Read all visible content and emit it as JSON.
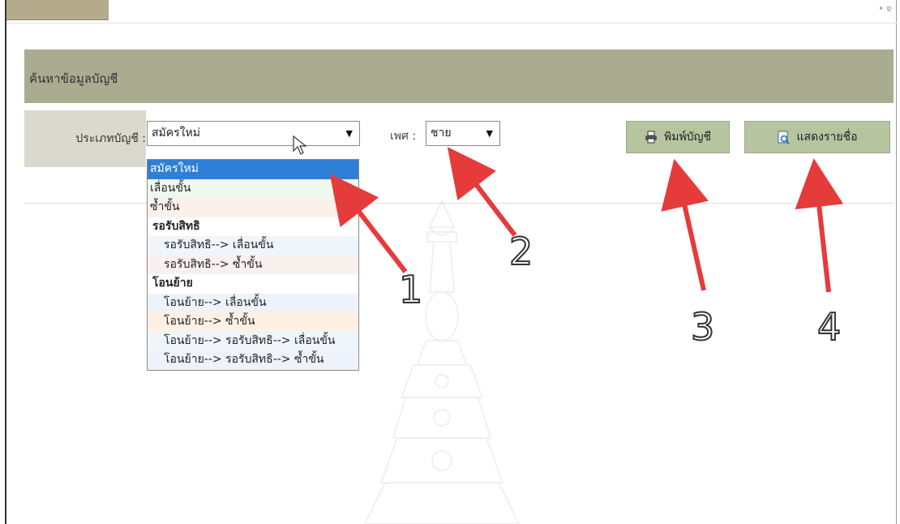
{
  "page": {
    "top_tab_label": "",
    "corner_mark": "• ɐ"
  },
  "header": {
    "title": "ค้นหาข้อมูลบัญชี"
  },
  "filters": {
    "account_type_label": "ประเภทบัญชี :",
    "account_type_value": "สมัครใหม่",
    "sex_label": "เพศ :",
    "sex_value": "ชาย"
  },
  "buttons": {
    "print_label": "พิมพ์บัญชี",
    "show_list_label": "แสดงรายชื่อ"
  },
  "dropdown": {
    "items": [
      {
        "label": "สมัครใหม่",
        "kind": "selected",
        "bg": "#2f7fd6"
      },
      {
        "label": "เลื่อนขั้น",
        "kind": "item",
        "bg": "#eef9ee"
      },
      {
        "label": "ซ้ำขั้น",
        "kind": "item",
        "bg": "#fbf0ea"
      },
      {
        "label": "รอรับสิทธิ",
        "kind": "group",
        "bg": "#ffffff"
      },
      {
        "label": "รอรับสิทธิ--> เลื่อนขั้น",
        "kind": "child",
        "bg": "#eef6fb"
      },
      {
        "label": "รอรับสิทธิ--> ซ้ำขั้น",
        "kind": "child",
        "bg": "#f8f1ee"
      },
      {
        "label": "โอนย้าย",
        "kind": "group",
        "bg": "#ffffff"
      },
      {
        "label": "โอนย้าย--> เลื่อนขั้น",
        "kind": "child",
        "bg": "#eef3fb"
      },
      {
        "label": "โอนย้าย--> ซ้ำขั้น",
        "kind": "child",
        "bg": "#fdf1e3"
      },
      {
        "label": "โอนย้าย--> รอรับสิทธิ--> เลื่อนขั้น",
        "kind": "child",
        "bg": "#eef6fb"
      },
      {
        "label": "โอนย้าย--> รอรับสิทธิ--> ซ้ำขั้น",
        "kind": "child",
        "bg": "#eef3fb"
      }
    ]
  },
  "annotations": {
    "n1": "1",
    "n2": "2",
    "n3": "3",
    "n4": "4",
    "arrow_color": "#e53b3b"
  },
  "colors": {
    "header_bg": "#a9ac8f",
    "label_bg": "#dad9cd",
    "button_bg": "#b6c4a0",
    "selected_bg": "#2f7fd6"
  }
}
